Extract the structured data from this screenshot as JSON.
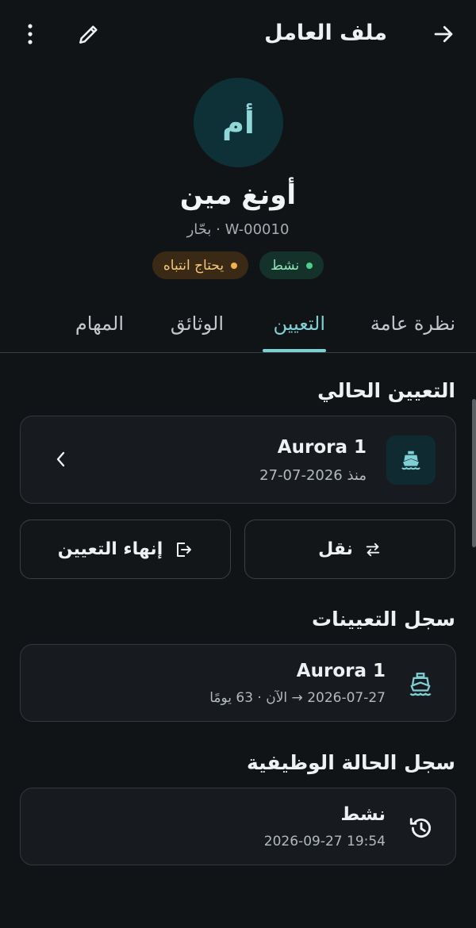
{
  "appbar": {
    "title": "ملف العامل",
    "back_icon": "arrow-forward-icon",
    "edit_icon": "pencil-icon",
    "more_icon": "more-vert-icon"
  },
  "profile": {
    "initials": "أم",
    "name": "أونغ مين",
    "subline": "W-00010 · بحّار",
    "badges": [
      {
        "label": "نشط",
        "color": "#4ad08a"
      },
      {
        "label": "يحتاج انتباه",
        "color": "#f0b24a"
      }
    ]
  },
  "tabs": [
    {
      "label": "نظرة عامة",
      "active": false
    },
    {
      "label": "التعيين",
      "active": true
    },
    {
      "label": "الوثائق",
      "active": false
    },
    {
      "label": "المهام",
      "active": false
    }
  ],
  "current_assignment": {
    "section_title": "التعيين الحالي",
    "vessel": "Aurora 1",
    "since": "منذ 2026-07-27",
    "icon": "ship-icon"
  },
  "actions": {
    "transfer_label": "نقل",
    "end_label": "إنهاء التعيين"
  },
  "assignment_history": {
    "section_title": "سجل التعيينات",
    "items": [
      {
        "vessel": "Aurora 1",
        "period": "2026-07-27 → الآن · 63 يومًا"
      }
    ]
  },
  "status_history": {
    "section_title": "سجل الحالة الوظيفية",
    "items": [
      {
        "status": "نشط",
        "timestamp": "2026-09-27 19:54"
      }
    ]
  },
  "colors": {
    "accent": "#7fd0d5",
    "background": "#111417",
    "card": "#171b1f"
  }
}
